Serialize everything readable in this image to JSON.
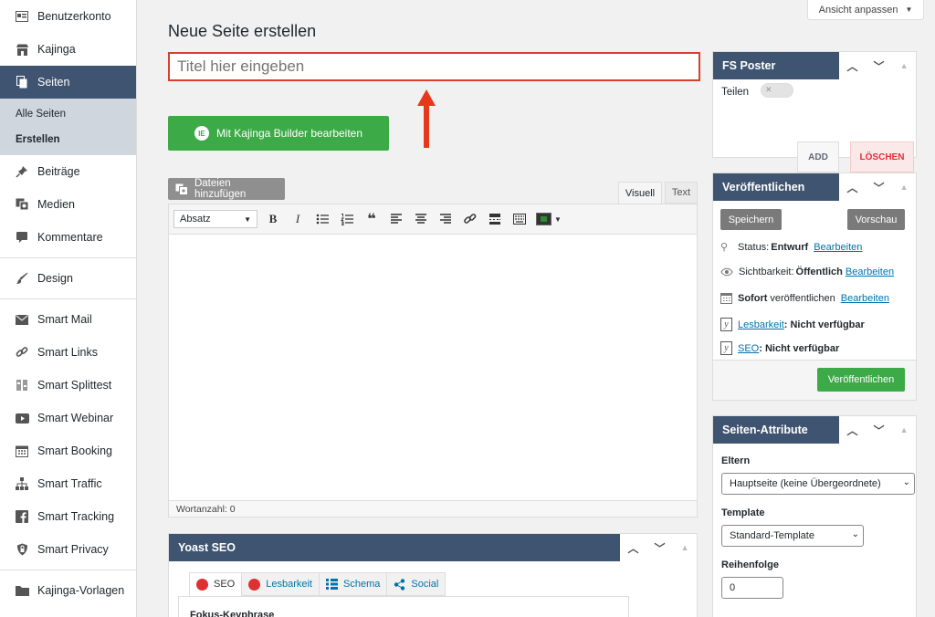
{
  "sidebar": {
    "items": [
      {
        "label": "Benutzerkonto",
        "icon": "id-card-icon"
      },
      {
        "label": "Kajinga",
        "icon": "store-icon"
      },
      {
        "label": "Seiten",
        "icon": "pages-icon"
      },
      {
        "label": "Beiträge",
        "icon": "pin-icon"
      },
      {
        "label": "Medien",
        "icon": "media-icon"
      },
      {
        "label": "Kommentare",
        "icon": "comment-icon"
      },
      {
        "label": "Design",
        "icon": "brush-icon"
      },
      {
        "label": "Smart Mail",
        "icon": "mail-icon"
      },
      {
        "label": "Smart Links",
        "icon": "link-icon"
      },
      {
        "label": "Smart Splittest",
        "icon": "splittest-icon"
      },
      {
        "label": "Smart Webinar",
        "icon": "video-icon"
      },
      {
        "label": "Smart Booking",
        "icon": "calendar-icon"
      },
      {
        "label": "Smart Traffic",
        "icon": "sitemap-icon"
      },
      {
        "label": "Smart Tracking",
        "icon": "facebook-icon"
      },
      {
        "label": "Smart Privacy",
        "icon": "shield-icon"
      },
      {
        "label": "Kajinga-Vorlagen",
        "icon": "folder-icon"
      }
    ],
    "submenu": [
      "Alle Seiten",
      "Erstellen"
    ]
  },
  "header": {
    "screen_options": "Ansicht anpassen",
    "page_title": "Neue Seite erstellen"
  },
  "title_input": {
    "placeholder": "Titel hier eingeben"
  },
  "builder_button": "Mit Kajinga Builder bearbeiten",
  "builder_icon_text": "IE",
  "media_button": "Dateien hinzufügen",
  "editor": {
    "tab_visual": "Visuell",
    "tab_text": "Text",
    "format": "Absatz",
    "bold": "B",
    "italic": "I",
    "quote": "❝",
    "wordcount": "Wortanzahl: 0"
  },
  "yoast": {
    "title": "Yoast SEO",
    "tabs": [
      "SEO",
      "Lesbarkeit",
      "Schema",
      "Social"
    ],
    "focus_label": "Fokus-Keyphrase"
  },
  "fs_poster": {
    "title": "FS Poster",
    "share_label": "Teilen",
    "toggle_mark": "✕",
    "add": "ADD",
    "delete": "LÖSCHEN"
  },
  "publish": {
    "title": "Veröffentlichen",
    "save": "Speichern",
    "preview": "Vorschau",
    "status_label": "Status:",
    "status_value": "Entwurf",
    "edit": "Bearbeiten",
    "visibility_label": "Sichtbarkeit:",
    "visibility_value": "Öffentlich",
    "immediately": "Sofort",
    "publish_text": "veröffentlichen",
    "readability_link": "Lesbarkeit",
    "readability_value": ": Nicht verfügbar",
    "seo_link": "SEO",
    "seo_value": ": Nicht verfügbar",
    "publish_button": "Veröffentlichen"
  },
  "attributes": {
    "title": "Seiten-Attribute",
    "parent_label": "Eltern",
    "parent_value": "Hauptseite (keine Übergeordnete)",
    "template_label": "Template",
    "template_value": "Standard-Template",
    "order_label": "Reihenfolge",
    "order_value": "0"
  },
  "colors": {
    "accent": "#3f5470",
    "green": "#3daa48",
    "highlight": "#d4412c"
  }
}
